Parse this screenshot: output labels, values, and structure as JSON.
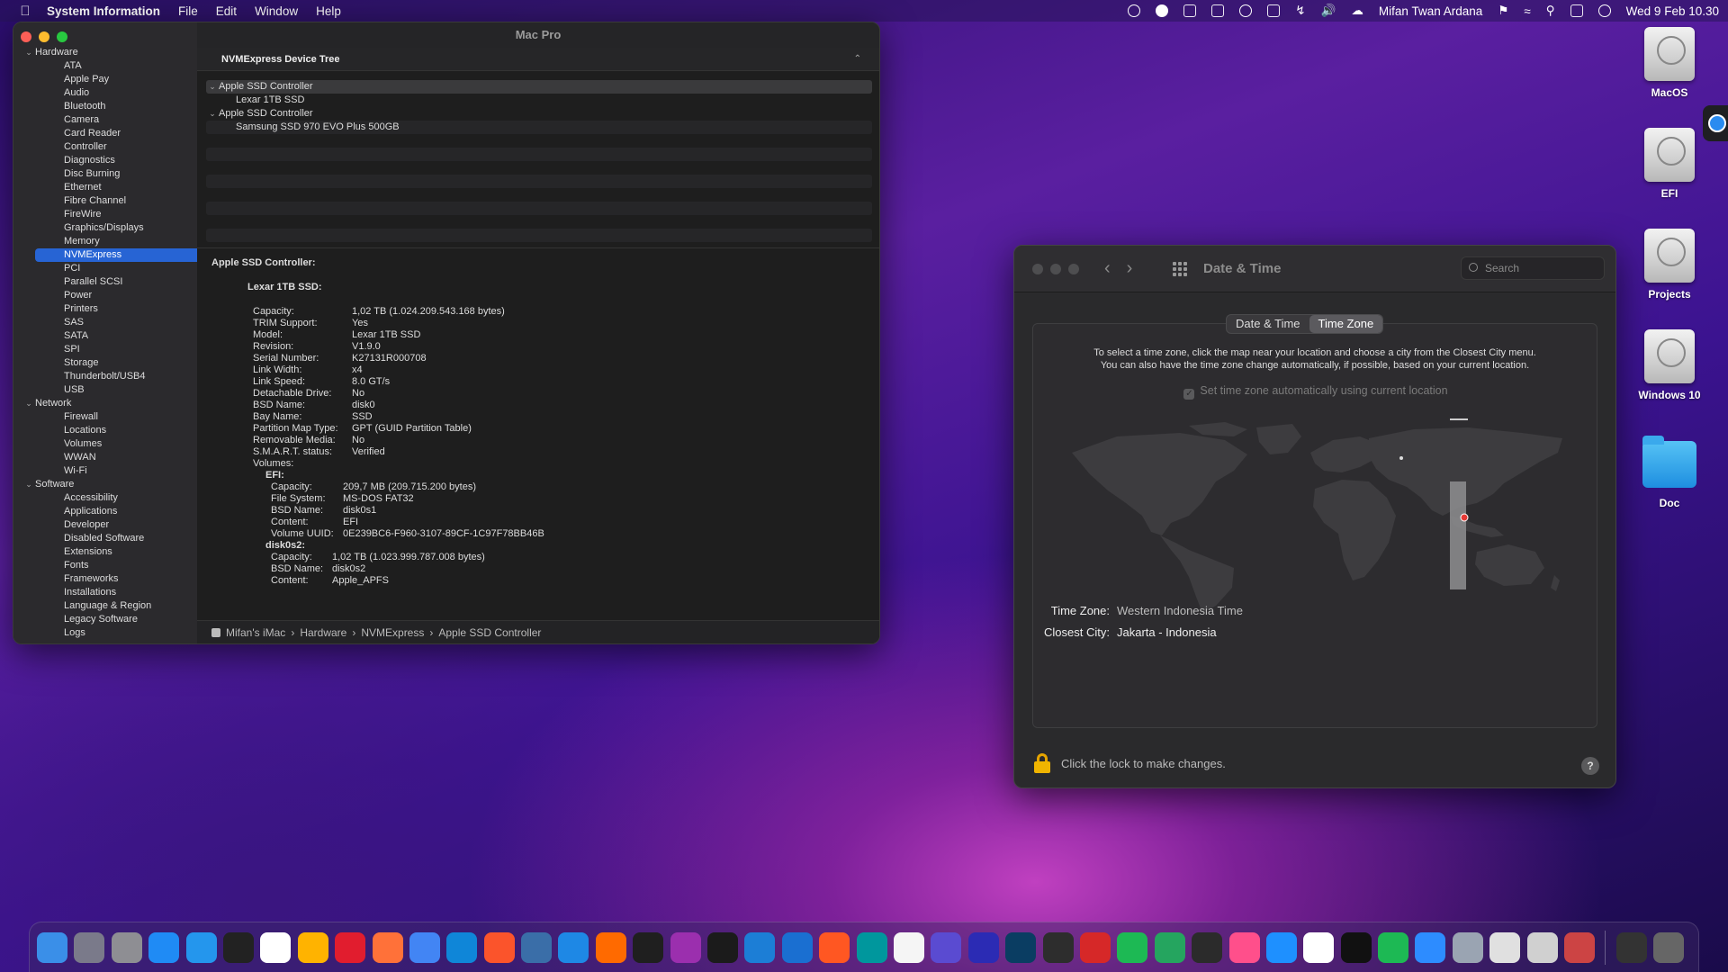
{
  "menubar": {
    "app_name": "System Information",
    "menus": [
      "File",
      "Edit",
      "Window",
      "Help"
    ],
    "user": "Mifan Twan Ardana",
    "clock": "Wed 9 Feb  10.30"
  },
  "sysinfo": {
    "title": "Mac Pro",
    "sidebar": {
      "groups": [
        {
          "label": "Hardware",
          "items": [
            "ATA",
            "Apple Pay",
            "Audio",
            "Bluetooth",
            "Camera",
            "Card Reader",
            "Controller",
            "Diagnostics",
            "Disc Burning",
            "Ethernet",
            "Fibre Channel",
            "FireWire",
            "Graphics/Displays",
            "Memory",
            "NVMExpress",
            "PCI",
            "Parallel SCSI",
            "Power",
            "Printers",
            "SAS",
            "SATA",
            "SPI",
            "Storage",
            "Thunderbolt/USB4",
            "USB"
          ]
        },
        {
          "label": "Network",
          "items": [
            "Firewall",
            "Locations",
            "Volumes",
            "WWAN",
            "Wi-Fi"
          ]
        },
        {
          "label": "Software",
          "items": [
            "Accessibility",
            "Applications",
            "Developer",
            "Disabled Software",
            "Extensions",
            "Fonts",
            "Frameworks",
            "Installations",
            "Language & Region",
            "Legacy Software",
            "Logs"
          ]
        }
      ],
      "selected": "NVMExpress"
    },
    "device_tree": {
      "header": "NVMExpress Device Tree",
      "rows": [
        {
          "label": "Apple SSD Controller",
          "level": 0
        },
        {
          "label": "Lexar 1TB SSD",
          "level": 1
        },
        {
          "label": "Apple SSD Controller",
          "level": 0
        },
        {
          "label": "Samsung SSD 970 EVO Plus 500GB",
          "level": 1
        }
      ]
    },
    "detail": {
      "controller": "Apple SSD Controller:",
      "device": "Lexar 1TB SSD:",
      "props": [
        {
          "k": "Capacity:",
          "v": "1,02 TB (1.024.209.543.168 bytes)"
        },
        {
          "k": "TRIM Support:",
          "v": "Yes"
        },
        {
          "k": "Model:",
          "v": "Lexar 1TB SSD"
        },
        {
          "k": "Revision:",
          "v": "V1.9.0"
        },
        {
          "k": "Serial Number:",
          "v": "K27131R000708"
        },
        {
          "k": "Link Width:",
          "v": "x4"
        },
        {
          "k": "Link Speed:",
          "v": "8.0 GT/s"
        },
        {
          "k": "Detachable Drive:",
          "v": "No"
        },
        {
          "k": "BSD Name:",
          "v": "disk0"
        },
        {
          "k": "Bay Name:",
          "v": "SSD"
        },
        {
          "k": "Partition Map Type:",
          "v": "GPT (GUID Partition Table)"
        },
        {
          "k": "Removable Media:",
          "v": "No"
        },
        {
          "k": "S.M.A.R.T. status:",
          "v": "Verified"
        },
        {
          "k": "Volumes:",
          "v": ""
        }
      ],
      "volumes": [
        {
          "name": "EFI:",
          "props": [
            {
              "k": "Capacity:",
              "v": "209,7 MB (209.715.200 bytes)"
            },
            {
              "k": "File System:",
              "v": "MS-DOS FAT32"
            },
            {
              "k": "BSD Name:",
              "v": "disk0s1"
            },
            {
              "k": "Content:",
              "v": "EFI"
            },
            {
              "k": "Volume UUID:",
              "v": "0E239BC6-F960-3107-89CF-1C97F78BB46B"
            }
          ]
        },
        {
          "name": "disk0s2:",
          "props": [
            {
              "k": "Capacity:",
              "v": "1,02 TB (1.023.999.787.008 bytes)"
            },
            {
              "k": "BSD Name:",
              "v": "disk0s2"
            },
            {
              "k": "Content:",
              "v": "Apple_APFS"
            }
          ]
        }
      ]
    },
    "breadcrumb": [
      "Mifan's iMac",
      "Hardware",
      "NVMExpress",
      "Apple SSD Controller"
    ]
  },
  "datetime": {
    "title": "Date & Time",
    "search_placeholder": "Search",
    "tabs": [
      "Date & Time",
      "Time Zone"
    ],
    "active_tab": "Time Zone",
    "info_line1": "To select a time zone, click the map near your location and choose a city from the Closest City menu.",
    "info_line2": "You can also have the time zone change automatically, if possible, based on your current location.",
    "auto_label": "Set time zone automatically using current location",
    "timezone_label": "Time Zone:",
    "timezone_value": "Western Indonesia Time",
    "city_label": "Closest City:",
    "city_value": "Jakarta - Indonesia",
    "lock_text": "Click the lock to make changes.",
    "help": "?"
  },
  "desktop": {
    "drives": [
      "MacOS",
      "EFI",
      "Projects",
      "Windows 10",
      "Doc"
    ]
  },
  "dock": {
    "colors": [
      "#3a8fe8",
      "#7a7a8a",
      "#8e8e93",
      "#1f8bf5",
      "#2496ed",
      "#222222",
      "#ffffff",
      "#ffb300",
      "#e11d2e",
      "#ff7139",
      "#4285f4",
      "#0f86d8",
      "#fb542b",
      "#3a6ea8",
      "#1e88e5",
      "#ff6a00",
      "#1f1f1f",
      "#9b2fae",
      "#1b1b1b",
      "#1c7ed6",
      "#1a6fd1",
      "#ff5722",
      "#00979d",
      "#f5f5f5",
      "#5a4bd1",
      "#2b2bb4",
      "#0a3d62",
      "#2d2d2d",
      "#d62828",
      "#1db954",
      "#25a55f",
      "#2b2b2b",
      "#ff4f8b",
      "#1e90ff",
      "#ffffff",
      "#111111",
      "#1db954",
      "#2d8cff",
      "#9aa4b2",
      "#e0e0e0",
      "#d0d0d0",
      "#c44",
      "#333",
      "#666"
    ]
  },
  "accent": "#2764d4"
}
